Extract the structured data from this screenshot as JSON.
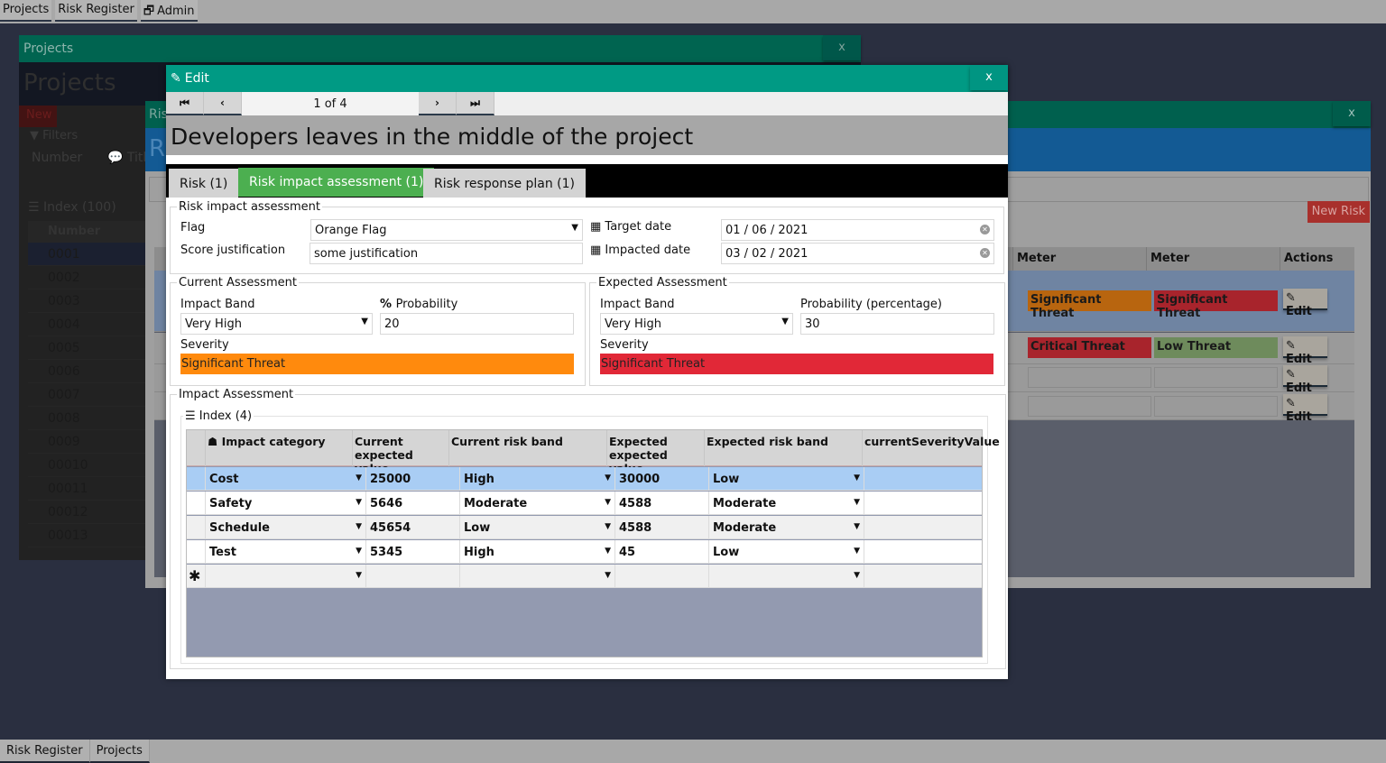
{
  "top_tabs": [
    {
      "label": "Projects"
    },
    {
      "label": "Risk Register"
    },
    {
      "label": "Admin",
      "icon": "window-restore-icon"
    }
  ],
  "bottom_tabs": [
    {
      "label": "Risk Register"
    },
    {
      "label": "Projects"
    }
  ],
  "projects_window": {
    "title": "Projects",
    "close_label": "x",
    "heading": "Projects",
    "new_label": "New",
    "filters_label": "Filters",
    "number_label": "Number",
    "title_label": "Title",
    "index_label": "Index (100)",
    "column_number": "Number",
    "rows": [
      "0001",
      "0002",
      "0003",
      "0004",
      "0005",
      "0006",
      "0007",
      "0008",
      "0009",
      "00010",
      "00011",
      "00012",
      "00013"
    ]
  },
  "risk_window": {
    "title": "Risk Register",
    "title_short": "Ris",
    "heading_short": "R",
    "close_label": "x",
    "new_risk_label": "New Risk",
    "columns": [
      "Meter",
      "Meter",
      "Actions"
    ],
    "rows": [
      {
        "current": "Significant Threat",
        "current_color": "#b8650f",
        "expected": "Significant Threat",
        "expected_color": "#a8242c",
        "action": "Edit"
      },
      {
        "current": "Critical Threat",
        "current_color": "#a8242c",
        "expected": "Low Threat",
        "expected_color": "#6e8b5c",
        "action": "Edit"
      },
      {
        "current": "",
        "expected": "",
        "action": "Edit"
      },
      {
        "current": "",
        "expected": "",
        "action": "Edit"
      }
    ]
  },
  "edit_dialog": {
    "title": "Edit",
    "close_label": "x",
    "pager": {
      "first": "⏮",
      "prev": "‹",
      "position": "1 of 4",
      "next": "›",
      "last": "⏭"
    },
    "record_title": "Developers leaves in the middle of the project",
    "tabs": [
      {
        "label": "Risk (1)",
        "active": false
      },
      {
        "label": "Risk impact assessment (1)",
        "active": true
      },
      {
        "label": "Risk response plan (1)",
        "active": false
      }
    ],
    "risk_impact": {
      "legend": "Risk impact assessment",
      "flag_label": "Flag",
      "flag_value": "Orange Flag",
      "score_label": "Score justification",
      "score_value": "some justification",
      "target_date_label": "Target date",
      "target_date_value": "01 / 06 / 2021",
      "impacted_date_label": "Impacted date",
      "impacted_date_value": "03 / 02 / 2021"
    },
    "current_assessment": {
      "legend": "Current Assessment",
      "impact_band_label": "Impact Band",
      "impact_band_value": "Very High",
      "probability_label": "Probability",
      "probability_value": "20",
      "severity_label": "Severity",
      "severity_value": "Significant Threat",
      "severity_color": "#ff8a0d"
    },
    "expected_assessment": {
      "legend": "Expected Assessment",
      "impact_band_label": "Impact Band",
      "impact_band_value": "Very High",
      "probability_label": "Probability (percentage)",
      "probability_value": "30",
      "severity_label": "Severity",
      "severity_value": "Significant Threat",
      "severity_color": "#e12837"
    },
    "impact_assessment": {
      "legend": "Impact Assessment",
      "index_label": "Index (4)",
      "columns": [
        "Impact category",
        "Current expected value",
        "Current risk band",
        "Expected expected value",
        "Expected risk band",
        "currentSeverityValue"
      ],
      "rows": [
        {
          "category": "Cost",
          "current_value": "25000",
          "current_band": "High",
          "expected_value": "30000",
          "expected_band": "Low",
          "severity": ""
        },
        {
          "category": "Safety",
          "current_value": "5646",
          "current_band": "Moderate",
          "expected_value": "4588",
          "expected_band": "Moderate",
          "severity": ""
        },
        {
          "category": "Schedule",
          "current_value": "45654",
          "current_band": "Low",
          "expected_value": "4588",
          "expected_band": "Moderate",
          "severity": ""
        },
        {
          "category": "Test",
          "current_value": "5345",
          "current_band": "High",
          "expected_value": "45",
          "expected_band": "Low",
          "severity": ""
        }
      ],
      "new_row_marker": "✱"
    }
  }
}
